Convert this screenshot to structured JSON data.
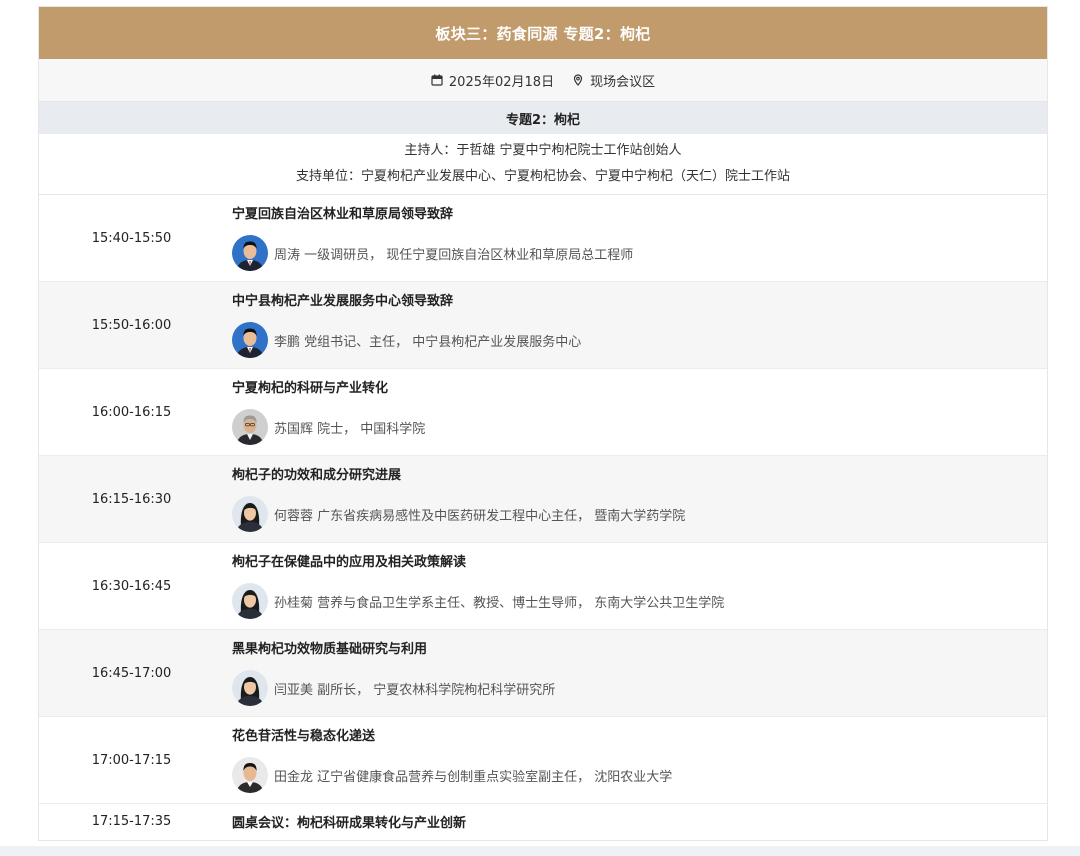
{
  "header": {
    "title": "板块三：药食同源 专题2：枸杞"
  },
  "info": {
    "date": "2025年02月18日",
    "location": "现场会议区"
  },
  "subheader": {
    "title": "专题2：枸杞"
  },
  "host": {
    "line1": "主持人：于哲雄 宁夏中宁枸杞院士工作站创始人",
    "line2": "支持单位：宁夏枸杞产业发展中心、宁夏枸杞协会、宁夏中宁枸杞（天仁）院士工作站"
  },
  "colors": {
    "accent": "#c19b6c",
    "info_bg": "#f7f7f7",
    "subhead_bg": "#e8ebef"
  },
  "sessions": [
    {
      "time": "15:40-15:50",
      "title": "宁夏回族自治区林业和草原局领导致辞",
      "speaker": "周涛 一级调研员， 现任宁夏回族自治区林业和草原局总工程师",
      "avatar": "avatar-male-formal"
    },
    {
      "time": "15:50-16:00",
      "title": "中宁县枸杞产业发展服务中心领导致辞",
      "speaker": "李鹏 党组书记、主任， 中宁县枸杞产业发展服务中心",
      "avatar": "avatar-male-formal"
    },
    {
      "time": "16:00-16:15",
      "title": "宁夏枸杞的科研与产业转化",
      "speaker": "苏国辉 院士， 中国科学院",
      "avatar": "avatar-male-senior"
    },
    {
      "time": "16:15-16:30",
      "title": "枸杞子的功效和成分研究进展",
      "speaker": "何蓉蓉 广东省疾病易感性及中医药研发工程中心主任， 暨南大学药学院",
      "avatar": "avatar-female"
    },
    {
      "time": "16:30-16:45",
      "title": "枸杞子在保健品中的应用及相关政策解读",
      "speaker": "孙桂菊 营养与食品卫生学系主任、教授、博士生导师， 东南大学公共卫生学院",
      "avatar": "avatar-female"
    },
    {
      "time": "16:45-17:00",
      "title": "黑果枸杞功效物质基础研究与利用",
      "speaker": "闫亚美 副所长， 宁夏农林科学院枸杞科学研究所",
      "avatar": "avatar-female"
    },
    {
      "time": "17:00-17:15",
      "title": "花色苷活性与稳态化递送",
      "speaker": "田金龙 辽宁省健康食品营养与创制重点实验室副主任， 沈阳农业大学",
      "avatar": "avatar-male"
    }
  ],
  "closing": {
    "time": "17:15-17:35",
    "title": "圆桌会议：枸杞科研成果转化与产业创新"
  }
}
